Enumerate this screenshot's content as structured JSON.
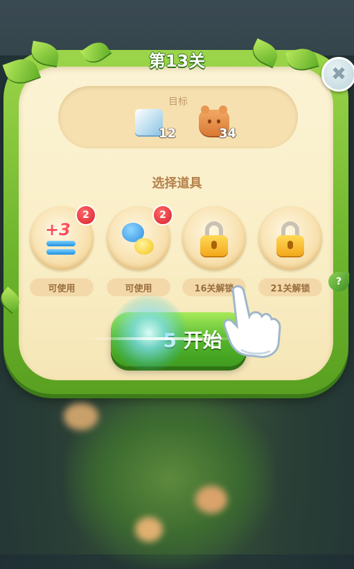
{
  "level": {
    "title": "第13关"
  },
  "goal": {
    "label": "目标",
    "items": [
      {
        "icon": "ice-block-icon",
        "count": "12"
      },
      {
        "icon": "cookie-bear-icon",
        "count": "34"
      }
    ]
  },
  "boosters": {
    "title": "选择道具",
    "items": [
      {
        "icon": "plus3-moves-icon",
        "badge": "2",
        "label": "可使用",
        "locked": false
      },
      {
        "icon": "creature-swap-icon",
        "badge": "2",
        "label": "可使用",
        "locked": false
      },
      {
        "icon": "padlock-icon",
        "label": "16关解锁",
        "locked": true
      },
      {
        "icon": "padlock-icon",
        "label": "21关解锁",
        "locked": true
      }
    ],
    "plus3_text": "+3",
    "help_text": "?"
  },
  "start_button": {
    "label": "5 开始"
  },
  "close_button": {
    "symbol": "✖"
  },
  "colors": {
    "panel_green": "#6cb52c",
    "panel_cream": "#fbf3d4",
    "accent_brown": "#b4804b"
  }
}
